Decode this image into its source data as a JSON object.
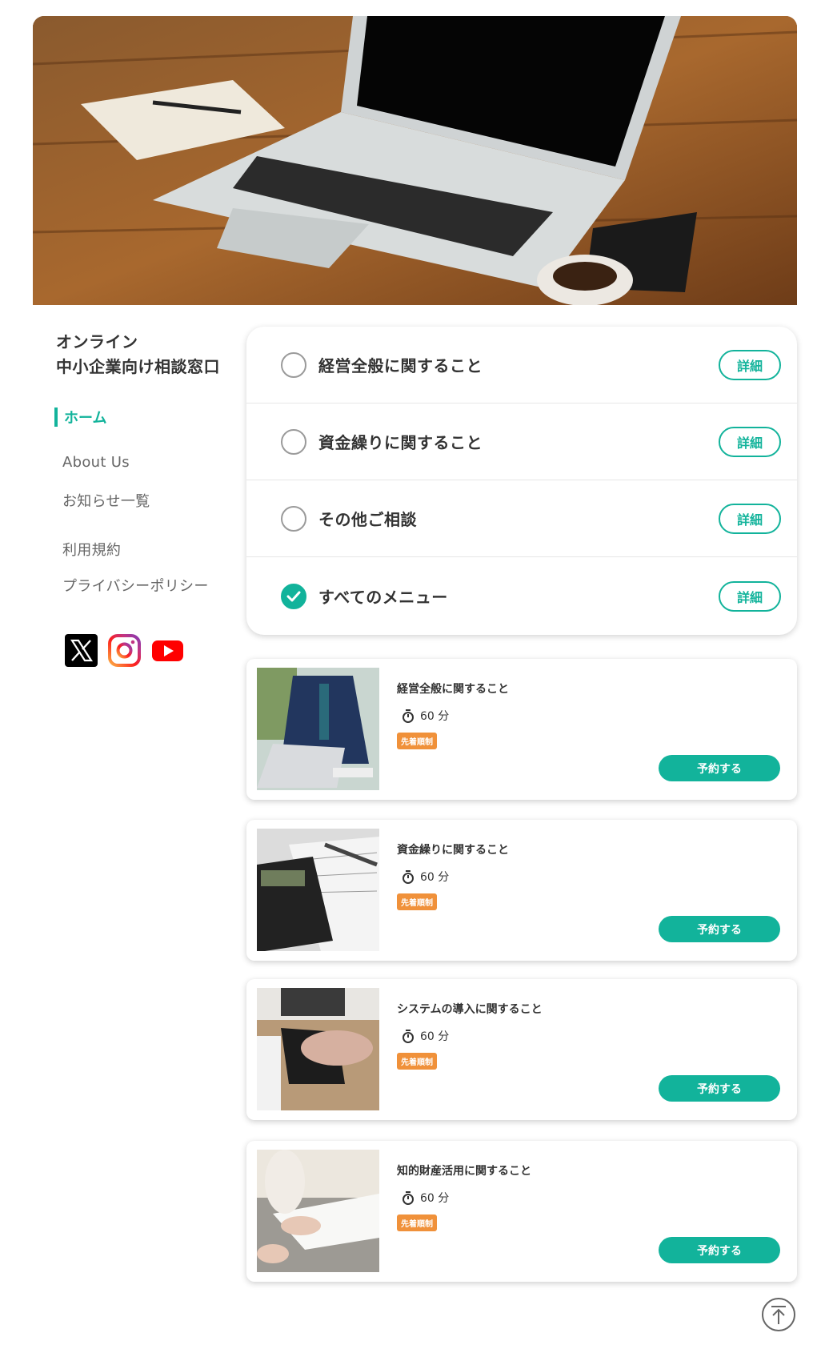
{
  "site": {
    "title_line1": "オンライン",
    "title_line2": "中小企業向け相談窓口"
  },
  "nav": {
    "home": "ホーム",
    "items": [
      "About Us",
      "お知らせ一覧",
      "利用規約",
      "プライバシーポリシー"
    ]
  },
  "socials": [
    "x-icon",
    "instagram-icon",
    "youtube-icon"
  ],
  "menu": {
    "items": [
      {
        "label": "経営全般に関すること",
        "checked": false,
        "button": "詳細"
      },
      {
        "label": "資金繰りに関すること",
        "checked": false,
        "button": "詳細"
      },
      {
        "label": "その他ご相談",
        "checked": false,
        "button": "詳細"
      },
      {
        "label": "すべてのメニュー",
        "checked": true,
        "button": "詳細"
      }
    ]
  },
  "courses": [
    {
      "title": "経営全般に関すること",
      "duration": "60 分",
      "badge": "先着順制",
      "button": "予約する"
    },
    {
      "title": "資金繰りに関すること",
      "duration": "60 分",
      "badge": "先着順制",
      "button": "予約する"
    },
    {
      "title": "システムの導入に関すること",
      "duration": "60 分",
      "badge": "先着順制",
      "button": "予約する"
    },
    {
      "title": "知的財産活用に関すること",
      "duration": "60 分",
      "badge": "先着順制",
      "button": "予約する"
    }
  ],
  "colors": {
    "accent": "#12b39b",
    "badge": "#f0913a",
    "text": "#333333"
  },
  "icons": {
    "scroll_top": "arrow-up-circle-icon",
    "timer": "stopwatch-icon",
    "check": "check-icon"
  }
}
